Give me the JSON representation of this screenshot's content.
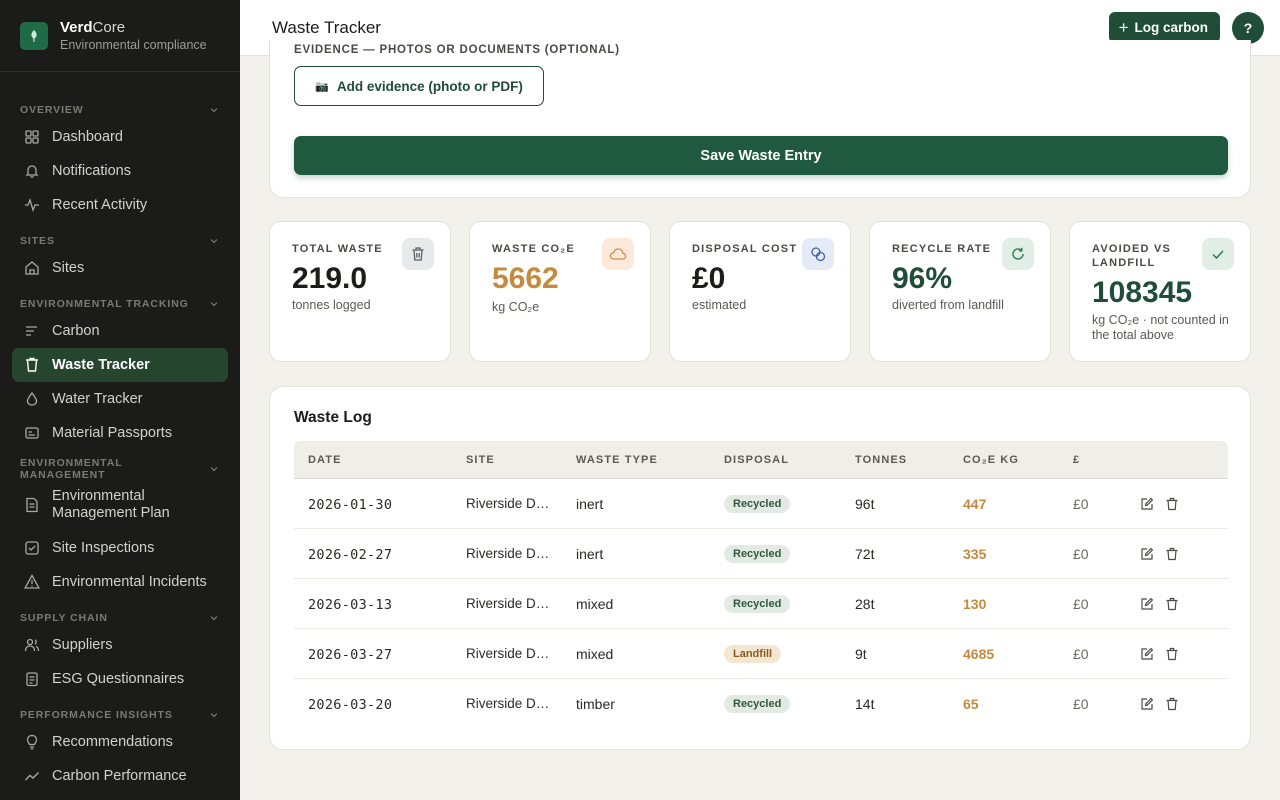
{
  "brand": {
    "name_bold": "Verd",
    "name_light": "Core",
    "subtitle": "Environmental compliance"
  },
  "sidebar": {
    "sections": [
      {
        "label": "Overview",
        "items": [
          {
            "label": "Dashboard",
            "icon": "grid-icon"
          },
          {
            "label": "Notifications",
            "icon": "bell-icon"
          },
          {
            "label": "Recent Activity",
            "icon": "activity-icon"
          }
        ]
      },
      {
        "label": "Sites",
        "items": [
          {
            "label": "Sites",
            "icon": "home-icon"
          }
        ]
      },
      {
        "label": "Environmental Tracking",
        "items": [
          {
            "label": "Carbon",
            "icon": "lines-icon"
          },
          {
            "label": "Waste Tracker",
            "icon": "bin-icon",
            "active": true
          },
          {
            "label": "Water Tracker",
            "icon": "droplet-icon"
          },
          {
            "label": "Material Passports",
            "icon": "card-icon"
          }
        ]
      },
      {
        "label": "Environmental Management",
        "items": [
          {
            "label": "Environmental Management Plan",
            "icon": "document-icon"
          },
          {
            "label": "Site Inspections",
            "icon": "checkbox-icon"
          },
          {
            "label": "Environmental Incidents",
            "icon": "warning-icon"
          }
        ]
      },
      {
        "label": "Supply Chain",
        "items": [
          {
            "label": "Suppliers",
            "icon": "users-icon"
          },
          {
            "label": "ESG Questionnaires",
            "icon": "clipboard-icon"
          }
        ]
      },
      {
        "label": "Performance Insights",
        "items": [
          {
            "label": "Recommendations",
            "icon": "lightbulb-icon"
          },
          {
            "label": "Carbon Performance",
            "icon": "trend-icon"
          }
        ]
      }
    ]
  },
  "header": {
    "title": "Waste Tracker",
    "log_button": "Log carbon",
    "help": "?"
  },
  "form": {
    "evidence_label": "EVIDENCE — PHOTOS OR DOCUMENTS (OPTIONAL)",
    "add_evidence": "Add evidence (photo or PDF)",
    "save": "Save Waste Entry"
  },
  "stats": [
    {
      "label": "Total Waste",
      "value": "219.0",
      "sub": "tonnes logged",
      "icon": "trash-icon",
      "tone": "dark"
    },
    {
      "label": "Waste CO₂e",
      "value": "5662",
      "sub": "kg CO₂e",
      "icon": "cloud-icon",
      "tone": "orange"
    },
    {
      "label": "Disposal Cost",
      "value": "£0",
      "sub": "estimated",
      "icon": "coins-icon",
      "tone": "dark"
    },
    {
      "label": "Recycle Rate",
      "value": "96%",
      "sub": "diverted from landfill",
      "icon": "refresh-icon",
      "tone": "green"
    },
    {
      "label": "Avoided vs Landfill",
      "value": "108345",
      "sub": "kg CO₂e · not counted in the total above",
      "icon": "check-icon",
      "tone": "green"
    }
  ],
  "log": {
    "title": "Waste Log",
    "columns": [
      "Date",
      "Site",
      "Waste Type",
      "Disposal",
      "Tonnes",
      "CO₂e kg",
      "£"
    ],
    "rows": [
      {
        "date": "2026-01-30",
        "site": "Riverside Development",
        "type": "inert",
        "disposal": "Recycled",
        "tonnes": "96t",
        "co2": "447",
        "cost": "£0"
      },
      {
        "date": "2026-02-27",
        "site": "Riverside Development",
        "type": "inert",
        "disposal": "Recycled",
        "tonnes": "72t",
        "co2": "335",
        "cost": "£0"
      },
      {
        "date": "2026-03-13",
        "site": "Riverside Development",
        "type": "mixed",
        "disposal": "Recycled",
        "tonnes": "28t",
        "co2": "130",
        "cost": "£0"
      },
      {
        "date": "2026-03-27",
        "site": "Riverside Development",
        "type": "mixed",
        "disposal": "Landfill",
        "tonnes": "9t",
        "co2": "4685",
        "cost": "£0"
      },
      {
        "date": "2026-03-20",
        "site": "Riverside Development",
        "type": "timber",
        "disposal": "Recycled",
        "tonnes": "14t",
        "co2": "65",
        "cost": "£0"
      }
    ]
  },
  "colors": {
    "accent": "#1f4d38",
    "co2": "#c58a3d",
    "sidebar": "#1b1c1a",
    "active": "#25452f"
  }
}
